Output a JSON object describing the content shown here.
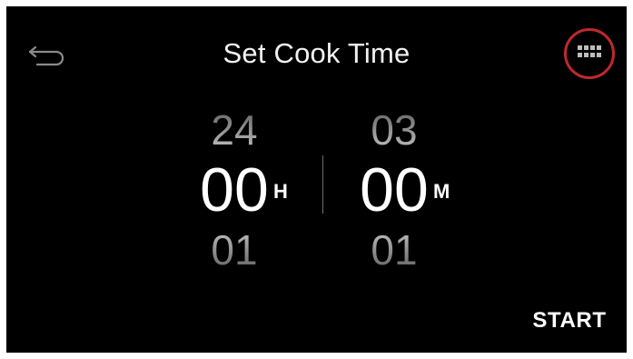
{
  "header": {
    "title": "Set Cook Time",
    "back_icon": "back-arrow-icon",
    "keypad_icon": "keypad-icon",
    "keypad_highlight_color": "#c0282d"
  },
  "time_picker": {
    "hours": {
      "previous": "24",
      "current": "00",
      "next": "01",
      "unit": "H"
    },
    "minutes": {
      "previous": "03",
      "current": "00",
      "next": "01",
      "unit": "M"
    }
  },
  "actions": {
    "start_label": "START"
  }
}
